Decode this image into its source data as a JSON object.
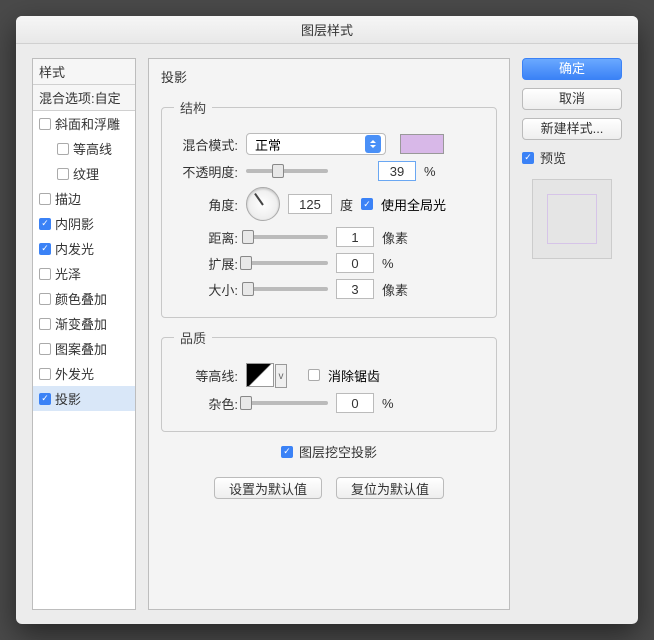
{
  "title": "图层样式",
  "sidebar": {
    "header_styles": "样式",
    "header_blend": "混合选项:自定",
    "items": [
      {
        "label": "斜面和浮雕",
        "checked": false,
        "indent": false
      },
      {
        "label": "等高线",
        "checked": false,
        "indent": true
      },
      {
        "label": "纹理",
        "checked": false,
        "indent": true
      },
      {
        "label": "描边",
        "checked": false,
        "indent": false
      },
      {
        "label": "内阴影",
        "checked": true,
        "indent": false
      },
      {
        "label": "内发光",
        "checked": true,
        "indent": false
      },
      {
        "label": "光泽",
        "checked": false,
        "indent": false
      },
      {
        "label": "颜色叠加",
        "checked": false,
        "indent": false
      },
      {
        "label": "渐变叠加",
        "checked": false,
        "indent": false
      },
      {
        "label": "图案叠加",
        "checked": false,
        "indent": false
      },
      {
        "label": "外发光",
        "checked": false,
        "indent": false
      },
      {
        "label": "投影",
        "checked": true,
        "indent": false,
        "selected": true
      }
    ]
  },
  "main": {
    "section": "投影",
    "structure": {
      "legend": "结构",
      "blend_label": "混合模式:",
      "blend_value": "正常",
      "color": "#d8b8e8",
      "opacity_label": "不透明度:",
      "opacity_value": "39",
      "opacity_unit": "%",
      "angle_label": "角度:",
      "angle_value": "125",
      "angle_unit": "度",
      "global_light_label": "使用全局光",
      "global_light_checked": true,
      "distance_label": "距离:",
      "distance_value": "1",
      "distance_unit": "像素",
      "spread_label": "扩展:",
      "spread_value": "0",
      "spread_unit": "%",
      "size_label": "大小:",
      "size_value": "3",
      "size_unit": "像素"
    },
    "quality": {
      "legend": "品质",
      "contour_label": "等高线:",
      "contour_arrow": "v",
      "antialias_label": "消除锯齿",
      "noise_label": "杂色:",
      "noise_value": "0",
      "noise_unit": "%"
    },
    "knockout_label": "图层挖空投影",
    "knockout_checked": true,
    "default_btn": "设置为默认值",
    "reset_btn": "复位为默认值"
  },
  "right": {
    "ok": "确定",
    "cancel": "取消",
    "new_style": "新建样式...",
    "preview_label": "预览",
    "preview_checked": true
  }
}
